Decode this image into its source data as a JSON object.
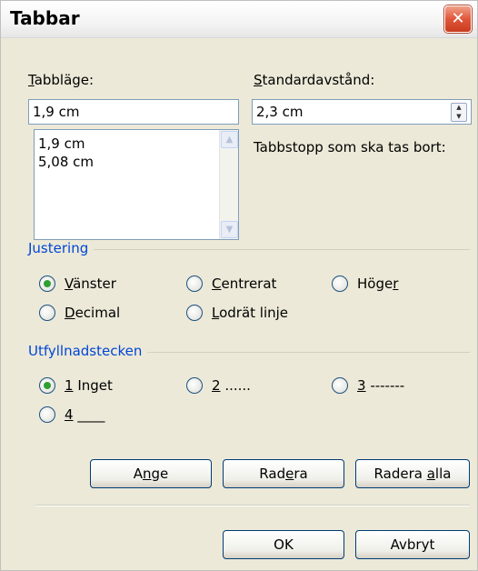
{
  "dialog": {
    "title": "Tabbar",
    "close_icon": "close-icon"
  },
  "tab_position": {
    "label": "Tabbläge:",
    "value": "1,9 cm",
    "items": [
      "1,9 cm",
      "5,08 cm"
    ]
  },
  "default_spacing": {
    "label": "Standardavstånd:",
    "value": "2,3 cm"
  },
  "tabs_to_clear": {
    "label": "Tabbstopp som ska tas bort:"
  },
  "alignment": {
    "title": "Justering",
    "options": {
      "left": "Vänster",
      "center": "Centrerat",
      "right": "Höger",
      "decimal": "Decimal",
      "bar": "Lodrät linje"
    },
    "selected": "Vänster"
  },
  "leader": {
    "title": "Utfyllnadstecken",
    "options": {
      "none": "1 Inget",
      "dots": "2 ......",
      "dashes": "3 -------",
      "underline": "4 ____"
    },
    "selected": "1 Inget"
  },
  "buttons": {
    "set": "Ange",
    "clear": "Radera",
    "clear_all": "Radera alla",
    "ok": "OK",
    "cancel": "Avbryt"
  },
  "colors": {
    "group_title": "#0046d5",
    "selected_radio": "#2fa033",
    "close_button": "#e0563a"
  }
}
